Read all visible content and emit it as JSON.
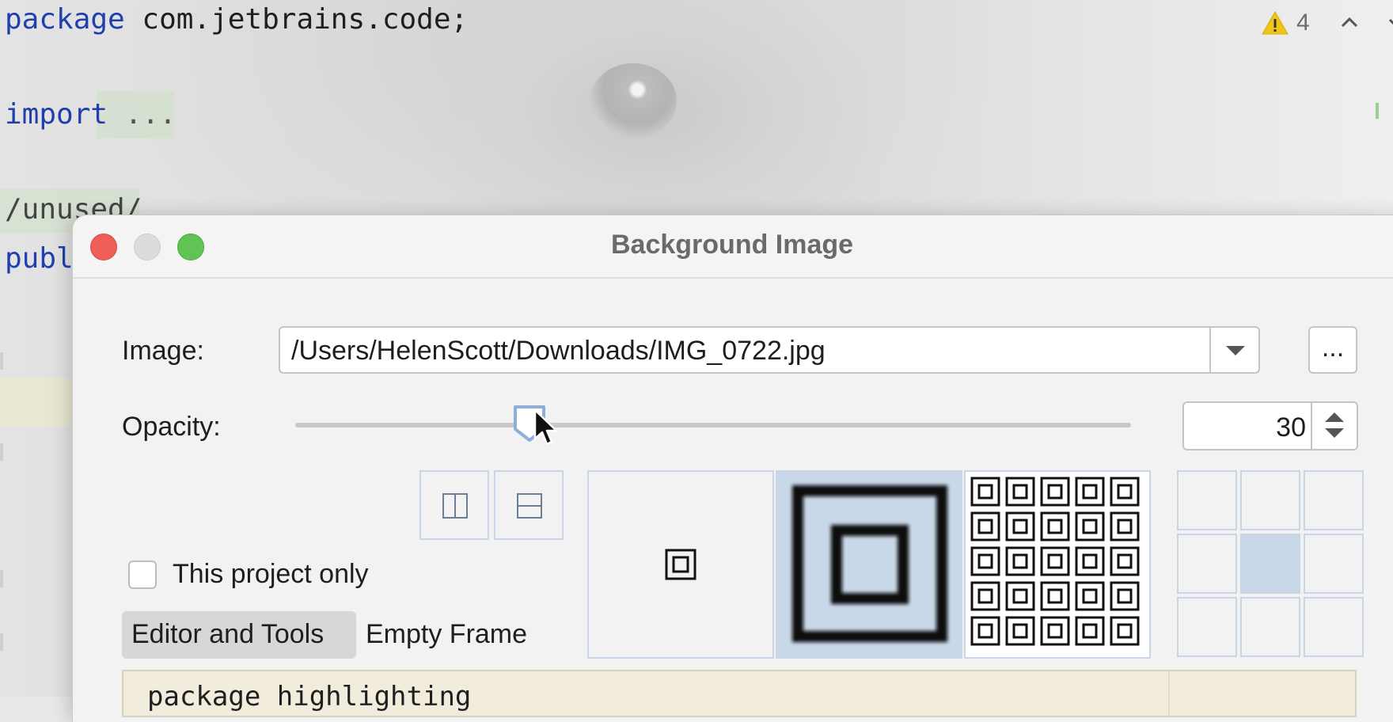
{
  "editor": {
    "lines": {
      "package_kw": "package",
      "package_name": " com.jetbrains.code;",
      "import_kw": "import",
      "import_fold": " ...",
      "comment": "/unused/",
      "public_kw": "publ"
    },
    "inspection": {
      "warning_count": "4"
    }
  },
  "dialog": {
    "title": "Background Image",
    "image_label": "Image:",
    "image_path": "/Users/HelenScott/Downloads/IMG_0722.jpg",
    "browse_label": "...",
    "opacity_label": "Opacity:",
    "opacity_value": "30",
    "opacity_fraction": 0.28,
    "this_project_only_label": "This project only",
    "this_project_only_checked": false,
    "tabs": [
      "Editor and Tools",
      "Empty Frame"
    ],
    "active_tab": "Editor and Tools",
    "fill_modes": [
      "center",
      "scale",
      "tile"
    ],
    "selected_fill_mode": "scale",
    "anchor_grid_selected": "center",
    "preview_text": "package highlighting"
  },
  "colors": {
    "keyword": "#1f3fae",
    "selection": "#c8d8e8",
    "close": "#ee5f57",
    "maximize": "#5fc454",
    "warning": "#f0c419"
  }
}
